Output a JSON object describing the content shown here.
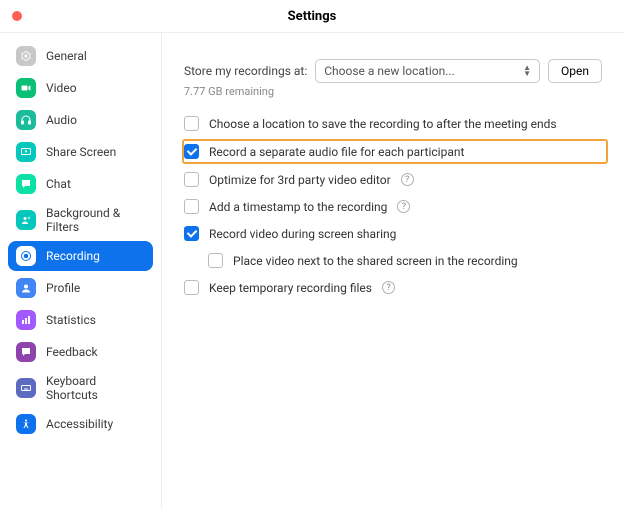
{
  "titlebar": {
    "title": "Settings"
  },
  "sidebar": {
    "items": [
      {
        "label": "General"
      },
      {
        "label": "Video"
      },
      {
        "label": "Audio"
      },
      {
        "label": "Share Screen"
      },
      {
        "label": "Chat"
      },
      {
        "label": "Background & Filters"
      },
      {
        "label": "Recording"
      },
      {
        "label": "Profile"
      },
      {
        "label": "Statistics"
      },
      {
        "label": "Feedback"
      },
      {
        "label": "Keyboard Shortcuts"
      },
      {
        "label": "Accessibility"
      }
    ]
  },
  "main": {
    "store_label": "Store my recordings at:",
    "location_select_text": "Choose a new location...",
    "open_button": "Open",
    "remaining": "7.77 GB remaining",
    "options": [
      {
        "label": "Choose a location to save the recording to after the meeting ends",
        "checked": false,
        "help": false
      },
      {
        "label": "Record a separate audio file for each participant",
        "checked": true,
        "help": false,
        "highlight": true
      },
      {
        "label": "Optimize for 3rd party video editor",
        "checked": false,
        "help": true
      },
      {
        "label": "Add a timestamp to the recording",
        "checked": false,
        "help": true
      },
      {
        "label": "Record video during screen sharing",
        "checked": true,
        "help": false
      },
      {
        "label": "Place video next to the shared screen in the recording",
        "checked": false,
        "help": false,
        "indent": true
      },
      {
        "label": "Keep temporary recording files",
        "checked": false,
        "help": true
      }
    ]
  }
}
